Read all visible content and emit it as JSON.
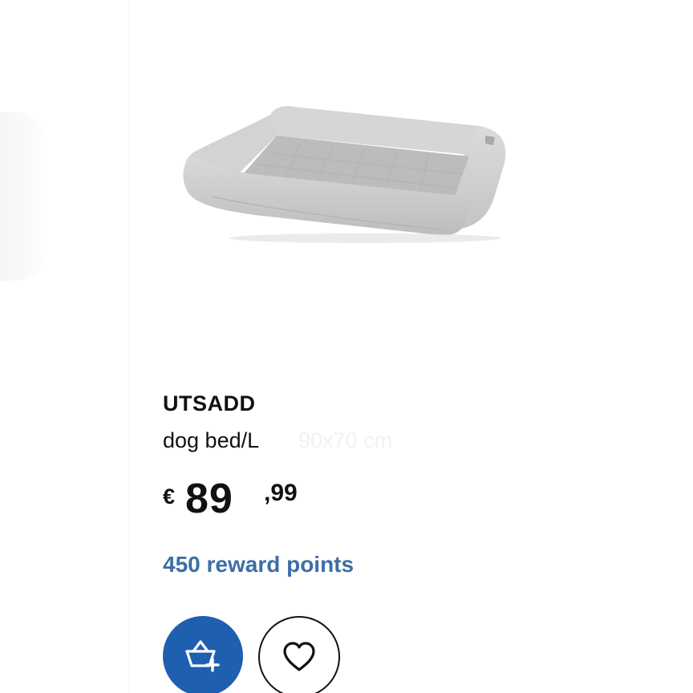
{
  "product": {
    "name": "UTSADD",
    "description": "dog bed/L",
    "ghost_text": "90x70 cm",
    "image_subject": "light grey rectangular dog bed",
    "price": {
      "currency": "€",
      "integer": "89",
      "decimal": ",99"
    },
    "reward_points": "450 reward points"
  },
  "actions": {
    "add_to_basket_icon": "basket-add-icon",
    "favourite_icon": "heart-icon"
  },
  "colors": {
    "accent_blue": "#1e5fb0",
    "reward_blue": "#3d6ea5",
    "text": "#111111",
    "background": "#ffffff"
  }
}
